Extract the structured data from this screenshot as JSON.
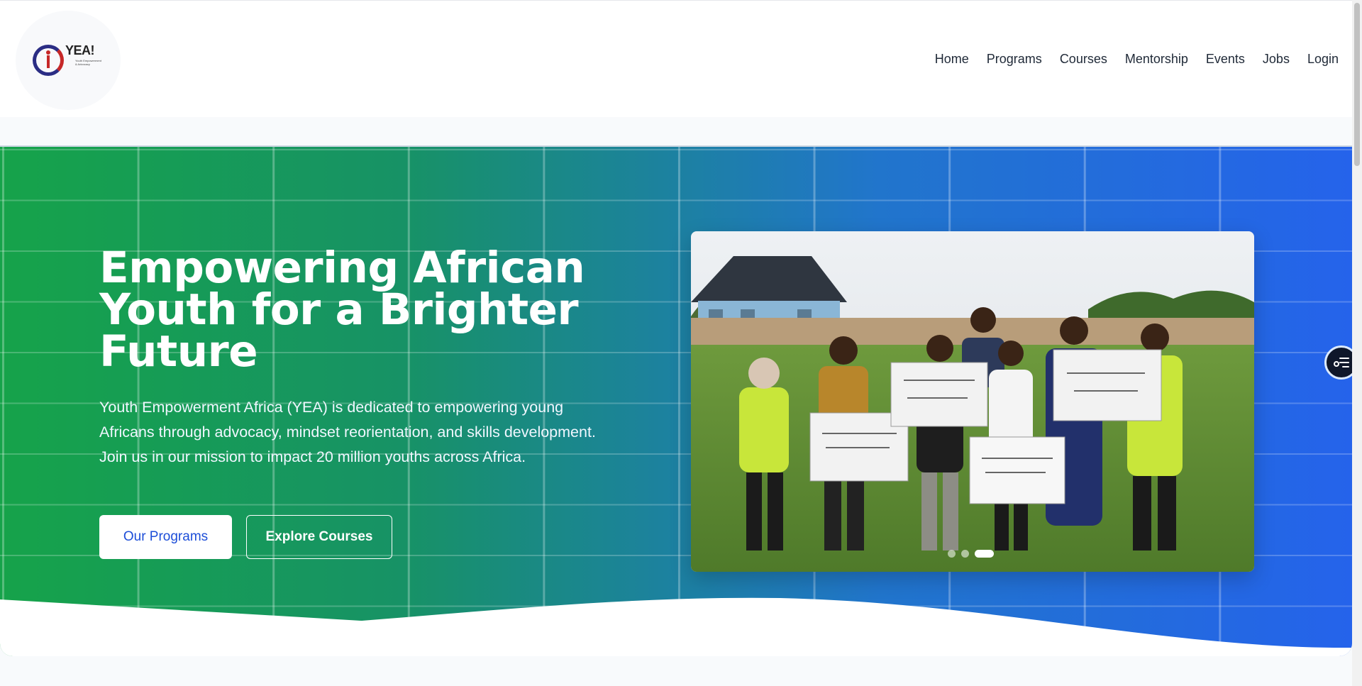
{
  "logo": {
    "text": "YEA!",
    "sub": "Youth Empowerment & Advocacy",
    "colors": {
      "ring": "#2b2d84",
      "figure": "#c62828"
    }
  },
  "nav": {
    "items": [
      "Home",
      "Programs",
      "Courses",
      "Mentorship",
      "Events",
      "Jobs",
      "Login"
    ]
  },
  "hero": {
    "title": "Empowering African Youth for a Brighter Future",
    "description": "Youth Empowerment Africa (YEA) is dedicated to empowering young Africans through advocacy, mindset reorientation, and skills development. Join us in our mission to impact 20 million youths across Africa.",
    "primary_button": "Our Programs",
    "secondary_button": "Explore Courses",
    "colors": {
      "gradient_start": "#16a34a",
      "gradient_end": "#2563eb"
    }
  },
  "carousel": {
    "slide_count": 3,
    "active_index": 2
  },
  "side_widget": {
    "icon": "list-settings-icon"
  }
}
